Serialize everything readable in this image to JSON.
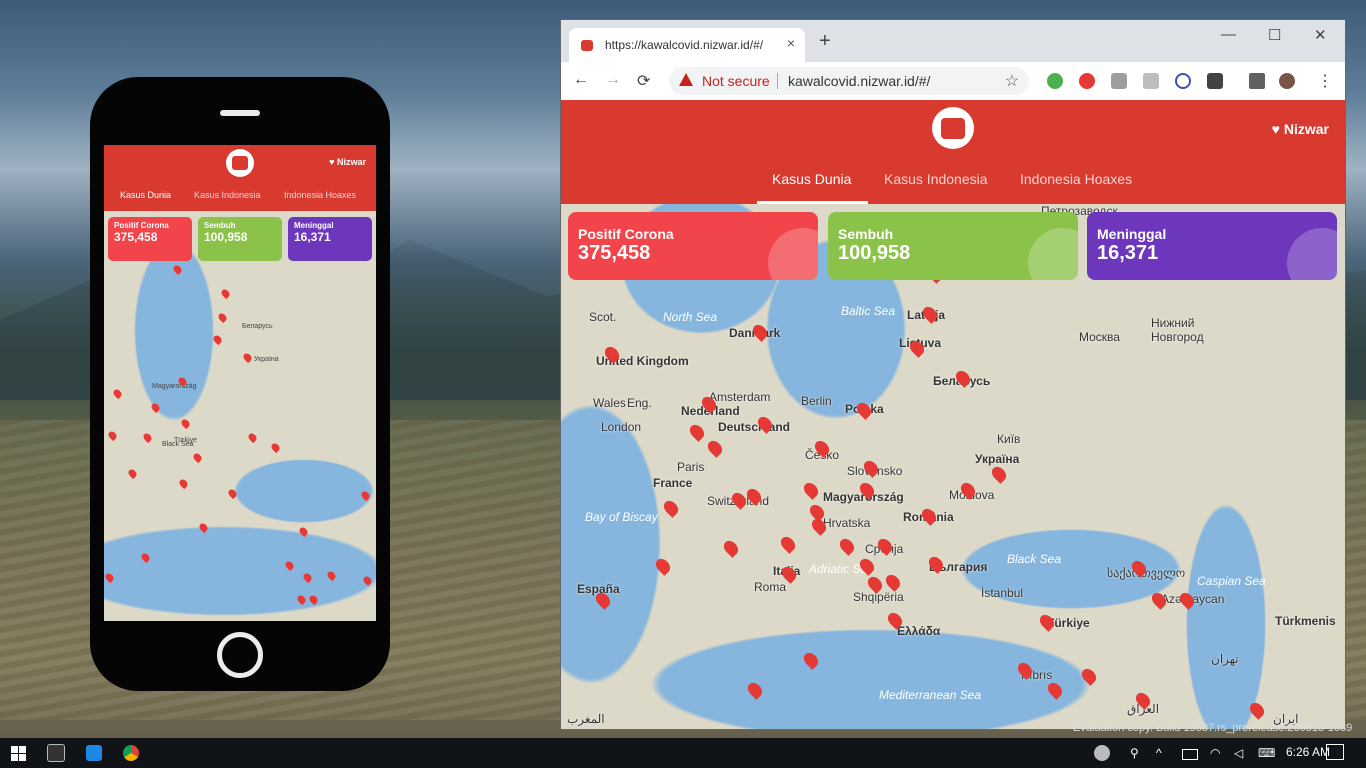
{
  "browser": {
    "tab_title": "https://kawalcovid.nizwar.id/#/",
    "tab_close": "×",
    "new_tab": "+",
    "window": {
      "minimize": "—",
      "maximize": "☐",
      "close": "✕"
    },
    "nav": {
      "back": "←",
      "forward": "→",
      "reload": "⟳"
    },
    "security_label": "Not secure",
    "url": "kawalcovid.nizwar.id/#/",
    "bookmark_star": "☆",
    "menu": "⋮"
  },
  "site": {
    "author": "♥ Nizwar",
    "tabs": [
      {
        "label": "Kasus Dunia"
      },
      {
        "label": "Kasus Indonesia"
      },
      {
        "label": "Indonesia Hoaxes"
      }
    ],
    "stats": [
      {
        "label": "Positif Corona",
        "value": "375,458",
        "color": "#f1444b"
      },
      {
        "label": "Sembuh",
        "value": "100,958",
        "color": "#8bc34a"
      },
      {
        "label": "Meninggal",
        "value": "16,371",
        "color": "#6c37bd"
      }
    ]
  },
  "map_labels": {
    "north_sea": "North Sea",
    "baltic_sea": "Baltic Sea",
    "black_sea": "Black Sea",
    "caspian_sea": "Caspian Sea",
    "mediterranean_sea": "Mediterranean Sea",
    "adriatic_sea": "Adriatic Sea",
    "bay_of_biscay": "Bay of Biscay",
    "united_kingdom": "United Kingdom",
    "danmark": "Danmark",
    "nederland": "Nederland",
    "deutschland": "Deutschland",
    "france": "France",
    "espana": "España",
    "italia": "Italia",
    "polska": "Polska",
    "belarus": "Беларусь",
    "ukraina": "Україна",
    "romania": "România",
    "turkiye": "Türkiye",
    "latvija": "Latvija",
    "lietuva": "Lietuva",
    "london": "London",
    "paris": "Paris",
    "berlin": "Berlin",
    "roma": "Roma",
    "moskva": "Москва",
    "kyiv": "Київ",
    "istanbul": "İstanbul",
    "amsterdam": "Amsterdam",
    "magyarorszag": "Magyarország",
    "bulgaria": "България",
    "ellada": "Ελλάδα",
    "petrozavodsk": "Петрозаводск",
    "nizhny": "Нижний Новгород",
    "turkmenis": "Türkmenis",
    "moldova": "Moldova",
    "switzerland": "Switzerland",
    "cesko": "Česko",
    "slovensko": "Slovensko",
    "hrvatska": "Hrvatska",
    "srbija": "Србија",
    "shqiperia": "Shqipëria",
    "iraq": "العراق",
    "maghrib": "المغرب",
    "iran": "ایران",
    "tehran": "تهران",
    "sakartvelo": "საქართველო",
    "azerbaycan": "Azərbaycan",
    "kibris": "Kıbrıs",
    "scot": "Scot.",
    "wales": "Wales",
    "eng": "Eng."
  },
  "desktop": {
    "eval_copy": "Evaluation copy. Build 19587.rs_prerelease.200313-1639",
    "clock": "6:26 AM"
  }
}
